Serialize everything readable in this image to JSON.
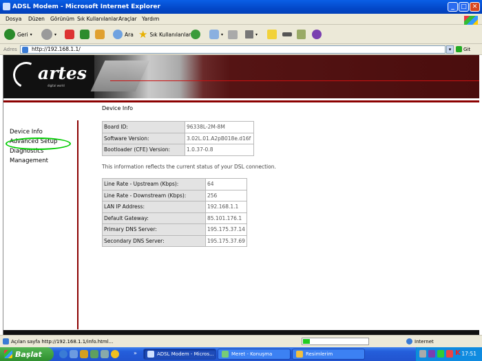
{
  "window": {
    "title": "ADSL Modem - Microsoft Internet Explorer",
    "min": "_",
    "max": "□",
    "close": "✕"
  },
  "menu": [
    "Dosya",
    "Düzen",
    "Görünüm",
    "Sık Kullanılanlar",
    "Araçlar",
    "Yardım"
  ],
  "toolbar": {
    "back": "Geri",
    "search": "Ara",
    "favorites": "Sık Kullanılanlar"
  },
  "address": {
    "label": "Adres",
    "url": "http://192.168.1.1/",
    "go": "Git"
  },
  "brand": {
    "name": "artes",
    "tagline": "digital world"
  },
  "sidebar": {
    "items": [
      "Device Info",
      "Advanced Setup",
      "Diagnostics",
      "Management"
    ]
  },
  "page": {
    "title": "Device Info",
    "device_rows": [
      {
        "key": "Board ID:",
        "value": "96338L-2M-8M"
      },
      {
        "key": "Software Version:",
        "value": "3.02L.01.A2pB018e.d16f"
      },
      {
        "key": "Bootloader (CFE) Version:",
        "value": "1.0.37-0.8"
      }
    ],
    "description": "This information reflects the current status of your DSL connection.",
    "status_rows": [
      {
        "key": "Line Rate - Upstream (Kbps):",
        "value": "64"
      },
      {
        "key": "Line Rate - Downstream (Kbps):",
        "value": "256"
      },
      {
        "key": "LAN IP Address:",
        "value": "192.168.1.1"
      },
      {
        "key": "Default Gateway:",
        "value": "85.101.176.1"
      },
      {
        "key": "Primary DNS Server:",
        "value": "195.175.37.14"
      },
      {
        "key": "Secondary DNS Server:",
        "value": "195.175.37.69"
      }
    ]
  },
  "status": {
    "text": "Açılan sayfa http://192.168.1.1/info.html...",
    "zone": "Internet",
    "progress_fraction": 0.1
  },
  "taskbar": {
    "start": "Başlat",
    "tasks": [
      "ADSL Modem - Micros...",
      "Meret - Konuşma",
      "Resimlerim"
    ],
    "clock": "17:51"
  },
  "colors": {
    "accent": "#8b0000",
    "highlight_ring": "#00cc00",
    "titlebar": "#0a5fe6"
  }
}
